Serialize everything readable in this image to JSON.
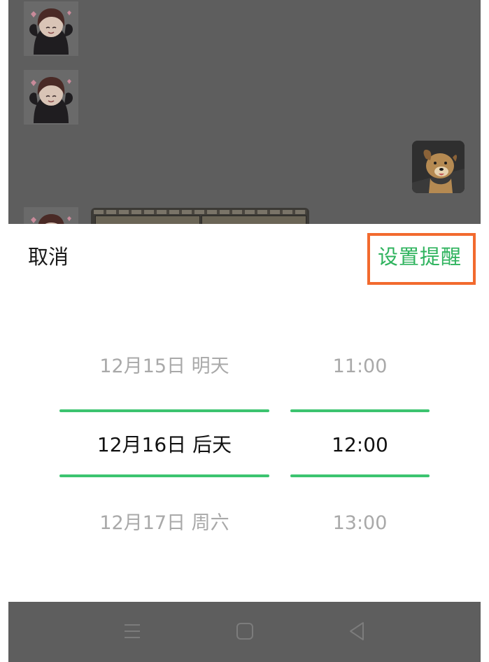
{
  "sheet": {
    "cancel_label": "取消",
    "confirm_label": "设置提醒"
  },
  "date_picker": {
    "items": [
      "12月15日 明天",
      "12月16日 后天",
      "12月17日 周六"
    ],
    "selected": "12月16日 后天"
  },
  "time_picker": {
    "items": [
      "11:00",
      "12:00",
      "13:00"
    ],
    "selected": "12:00"
  },
  "chat": {
    "stickers": [
      "anime-girl-sticker",
      "anime-girl-sticker",
      "anime-girl-sticker"
    ],
    "contact_avatar": "dog-avatar",
    "image_message": "image-message"
  },
  "nav_bar": {
    "buttons": [
      "menu-icon",
      "home-icon",
      "back-icon"
    ]
  },
  "colors": {
    "accent_green": "#2fb35e",
    "selection_line": "#3cc470",
    "highlight_frame": "#f26a2e",
    "dim_overlay": "#5e5e5e",
    "unselected_text": "#a9a9a9"
  }
}
